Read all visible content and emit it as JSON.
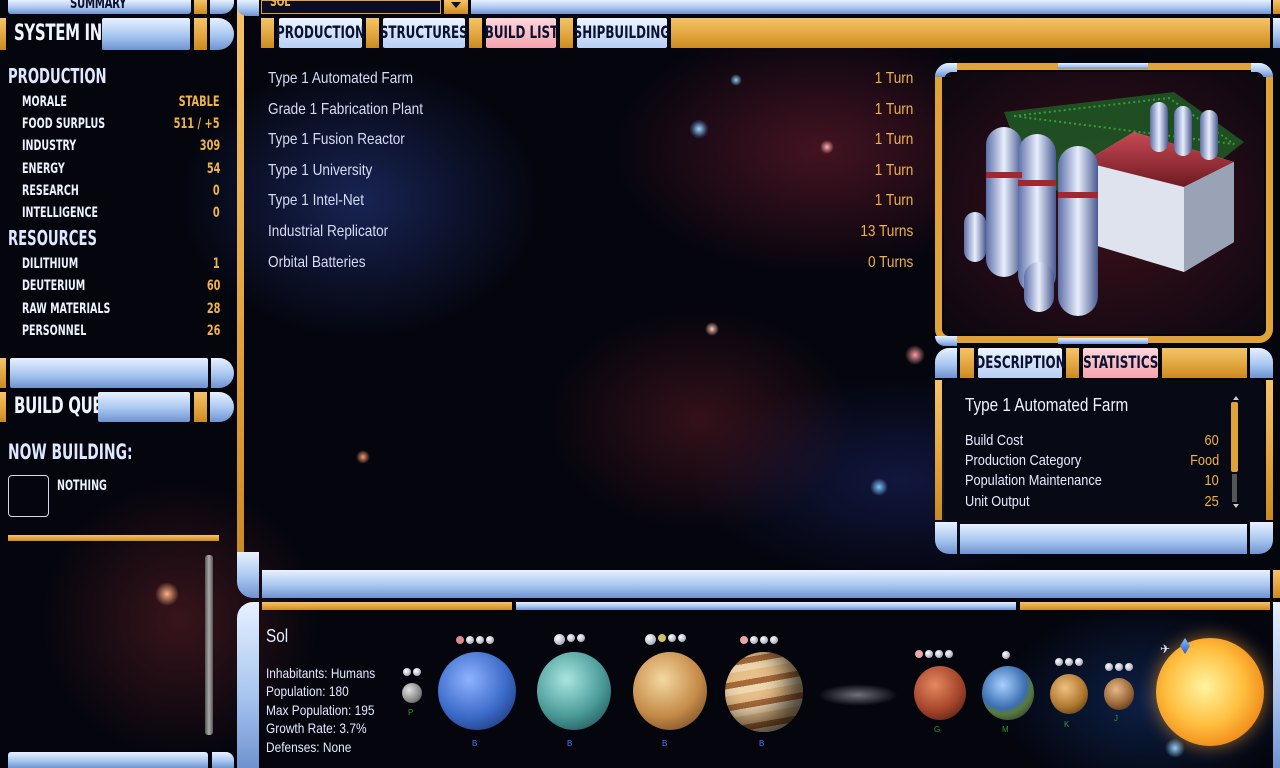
{
  "left_panel": {
    "summary_label": "SUMMARY",
    "system_info_label": "SYSTEM INFO",
    "production_header": "PRODUCTION",
    "production_stats": [
      {
        "label": "MORALE",
        "value": "STABLE"
      },
      {
        "label": "FOOD SURPLUS",
        "value": "511 / +5"
      },
      {
        "label": "INDUSTRY",
        "value": "309"
      },
      {
        "label": "ENERGY",
        "value": "54"
      },
      {
        "label": "RESEARCH",
        "value": "0"
      },
      {
        "label": "INTELLIGENCE",
        "value": "0"
      }
    ],
    "resources_header": "RESOURCES",
    "resources_stats": [
      {
        "label": "DILITHIUM",
        "value": "1"
      },
      {
        "label": "DEUTERIUM",
        "value": "60"
      },
      {
        "label": "RAW MATERIALS",
        "value": "28"
      },
      {
        "label": "PERSONNEL",
        "value": "26"
      }
    ],
    "build_queue_label": "BUILD QUEUE",
    "now_building_label": "NOW BUILDING:",
    "now_building_value": "NOTHING"
  },
  "top": {
    "system_selector": "SOL",
    "tabs": [
      {
        "label": "PRODUCTION"
      },
      {
        "label": "STRUCTURES"
      },
      {
        "label": "BUILD LIST"
      },
      {
        "label": "SHIPBUILDING"
      }
    ]
  },
  "build_list": [
    {
      "name": "Type 1 Automated Farm",
      "turns": "1 Turn"
    },
    {
      "name": "Grade 1 Fabrication Plant",
      "turns": "1 Turn"
    },
    {
      "name": "Type 1 Fusion Reactor",
      "turns": "1 Turn"
    },
    {
      "name": "Type 1 University",
      "turns": "1 Turn"
    },
    {
      "name": "Type 1 Intel-Net",
      "turns": "1 Turn"
    },
    {
      "name": "Industrial Replicator",
      "turns": "13 Turns"
    },
    {
      "name": "Orbital Batteries",
      "turns": "0 Turns"
    }
  ],
  "detail": {
    "tabs": [
      {
        "label": "DESCRIPTION"
      },
      {
        "label": "STATISTICS"
      }
    ],
    "title": "Type 1 Automated Farm",
    "rows": [
      {
        "label": "Build Cost",
        "value": "60"
      },
      {
        "label": "Production Category",
        "value": "Food"
      },
      {
        "label": "Population Maintenance",
        "value": "10"
      },
      {
        "label": "Unit Output",
        "value": "25"
      }
    ]
  },
  "system": {
    "name": "Sol",
    "inhabitants": "Inhabitants:  Humans",
    "population": "Population:  180",
    "max_population": "Max Population:  195",
    "growth_rate": "Growth Rate:  3.7%",
    "defenses": "Defenses: None",
    "planet_letters": [
      "P",
      "B",
      "B",
      "B",
      "B",
      "G",
      "M",
      "K",
      "J"
    ]
  },
  "colors": {
    "lcars_gold": "#e0a33a",
    "lcars_blue": "#a8c6f0",
    "tab_pink": "#f4a4ae",
    "value_orange": "#f0b24a"
  }
}
